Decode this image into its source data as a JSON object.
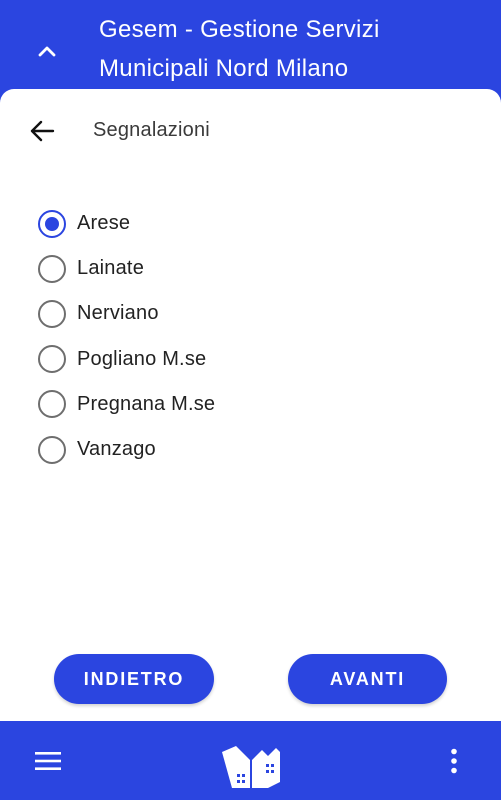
{
  "header": {
    "title": "Gesem - Gestione Servizi Municipali Nord Milano",
    "collapse_icon": "chevron-up-icon"
  },
  "page": {
    "title": "Segnalazioni",
    "back_icon": "arrow-left-icon"
  },
  "options": [
    {
      "label": "Arese",
      "checked": true
    },
    {
      "label": "Lainate",
      "checked": false
    },
    {
      "label": "Nerviano",
      "checked": false
    },
    {
      "label": "Pogliano M.se",
      "checked": false
    },
    {
      "label": "Pregnana M.se",
      "checked": false
    },
    {
      "label": "Vanzago",
      "checked": false
    }
  ],
  "buttons": {
    "back_label": "INDIETRO",
    "next_label": "AVANTI"
  },
  "bottom_bar": {
    "menu_icon": "hamburger-menu-icon",
    "logo_icon": "gesem-logo-icon",
    "more_icon": "more-vertical-icon"
  },
  "colors": {
    "primary": "#2b45e0",
    "surface": "#ffffff",
    "radio_unchecked": "#6e6e6e"
  }
}
